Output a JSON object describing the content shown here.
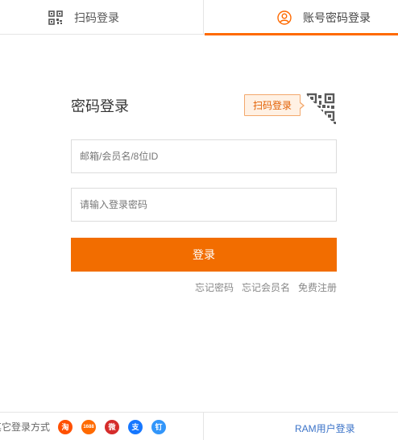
{
  "tabs": {
    "qr_label": "扫码登录",
    "password_label": "账号密码登录"
  },
  "form": {
    "title": "密码登录",
    "qr_tip": "扫码登录",
    "account_placeholder": "邮箱/会员名/8位ID",
    "password_placeholder": "请输入登录密码",
    "login_label": "登录"
  },
  "links": {
    "forgot_password": "忘记密码",
    "forgot_member": "忘记会员名",
    "register": "免费注册"
  },
  "footer": {
    "other_methods": "其它登录方式",
    "social": [
      {
        "name": "taobao",
        "glyph": "淘",
        "color": "#ff5000"
      },
      {
        "name": "1688",
        "glyph": "1688",
        "color": "#ff6a00"
      },
      {
        "name": "weibo",
        "glyph": "微",
        "color": "#d52c2b"
      },
      {
        "name": "alipay",
        "glyph": "支",
        "color": "#1677ff"
      },
      {
        "name": "dingtalk",
        "glyph": "钉",
        "color": "#3296fa"
      }
    ],
    "ram_login": "RAM用户登录"
  },
  "colors": {
    "accent": "#ff6a00",
    "button": "#f26d00",
    "link_blue": "#3b73c8"
  }
}
